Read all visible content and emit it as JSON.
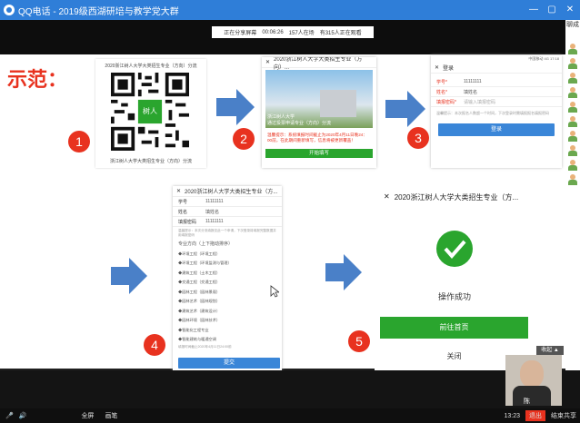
{
  "window": {
    "title": "QQ电话 - 2019级西湖研培与教学党大群",
    "controls": [
      "—",
      "▢",
      "✕"
    ]
  },
  "share_bar": {
    "items": [
      "正在分享屏幕",
      "00:06:26",
      "157人在场",
      "有315人正在观看"
    ]
  },
  "sidebar": {
    "label": "聊成"
  },
  "slide": {
    "demo_label": "示范：",
    "step_numbers": [
      "1",
      "2",
      "3",
      "4",
      "5"
    ],
    "qr_card": {
      "title": "2020浙江树人大学大类招生专业（方向）分流",
      "caption": "浙江树人大学大类招生专业（方向）分流",
      "center_label": "树人"
    },
    "screen2": {
      "header": "2020浙江树人大学大类招生专业（方向）...",
      "banner_text": "浙江树人大学\n通过投票申请专业（方向）分流",
      "notice": "温馨提示：系统填报时间截止为2020年4月11日晚24：00前，在此期间重新填写，信息将被更新覆盖！",
      "button": "开始填写"
    },
    "screen3": {
      "status": "中国移动 4G 17:18",
      "title": "登录",
      "fields": [
        {
          "label": "学号*",
          "value": "11111111"
        },
        {
          "label": "姓名*",
          "value": "填姓名"
        },
        {
          "label": "填报密码*",
          "value": "请输入填报密码"
        }
      ],
      "hint": "温馨提示：本次报名人数超一个时间，下次登录时需填报报名填报密码",
      "button": "登录"
    },
    "screen4": {
      "header": "2020浙江树人大学大类招生专业（方...",
      "fields": [
        {
          "label": "学号",
          "value": "11111111"
        },
        {
          "label": "姓名",
          "value": "填姓名"
        },
        {
          "label": "填报密码",
          "value": "11111111"
        }
      ],
      "hint": "温馨提示：本次分流填报仅此一个申请，下次登录将填报完整数据并用填报密码",
      "section": "专业方向（上下拖动排序）",
      "options": [
        "◆环境工程（环境工程）",
        "◆环境工程（环境监测与管理）",
        "◆建筑工程（土木工程）",
        "◆交通工程（交通工程）",
        "◆园林工程（园林景观）",
        "◆园林艺术（园林规划）",
        "◆建筑艺术（建筑设计）",
        "◆园林环境（园林技术）",
        "◆智能化工程专业",
        "◆智能建筑与暖通空调"
      ],
      "footer": "填报时间截止2020年4月11日24:00前",
      "button": "提交"
    },
    "screen5": {
      "title": "2020浙江树人大学大类招生专业（方...",
      "success": "操作成功",
      "primary": "前往首页",
      "secondary": "关闭"
    }
  },
  "controls": {
    "items": [
      "🎤",
      "🔊",
      "全屏",
      "画笔"
    ],
    "time": "13:23",
    "exit": "退出",
    "end": "结束共享"
  },
  "video": {
    "label": "陈"
  },
  "collapse": "收起 ▲",
  "colors": {
    "accent_red": "#e8321f",
    "arrow_blue": "#4a80c8",
    "brand_green": "#2aa52e",
    "title_blue": "#2f7ed8"
  }
}
